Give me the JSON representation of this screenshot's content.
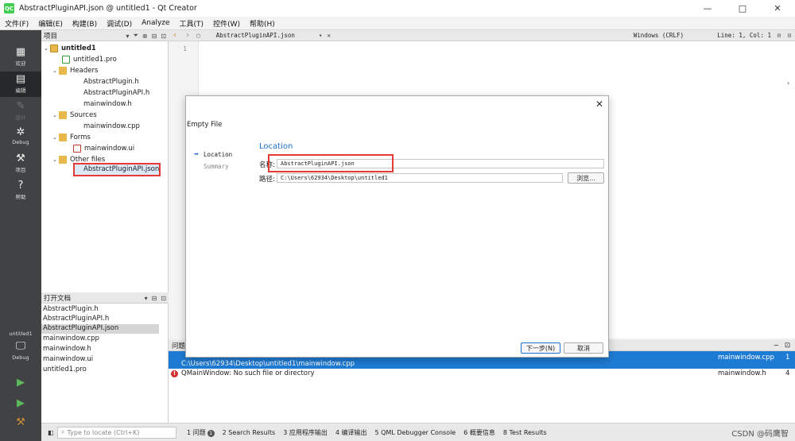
{
  "window": {
    "title": "AbstractPluginAPI.json @ untitled1 - Qt Creator",
    "controls": [
      "—",
      "□",
      "✕"
    ]
  },
  "menu": [
    "文件(F)",
    "编辑(E)",
    "构建(B)",
    "调试(D)",
    "Analyze",
    "工具(T)",
    "控件(W)",
    "帮助(H)"
  ],
  "modes": [
    {
      "label": "欢迎",
      "icon": "grid-icon",
      "glyph": "▦"
    },
    {
      "label": "编辑",
      "icon": "edit-icon",
      "glyph": "▤"
    },
    {
      "label": "设计",
      "icon": "design-icon",
      "glyph": "✎"
    },
    {
      "label": "Debug",
      "icon": "bug-icon",
      "glyph": "✲"
    },
    {
      "label": "项目",
      "icon": "wrench-icon",
      "glyph": "⚒"
    },
    {
      "label": "帮助",
      "icon": "help-icon",
      "glyph": "?"
    }
  ],
  "kit": {
    "name": "untitled1",
    "mode": "Debug"
  },
  "project_panel": {
    "title": "项目",
    "tree": {
      "project": "untitled1",
      "pro_file": "untitled1.pro",
      "headers": "Headers",
      "header_files": [
        "AbstractPlugin.h",
        "AbstractPluginAPI.h",
        "mainwindow.h"
      ],
      "sources": "Sources",
      "source_files": [
        "mainwindow.cpp"
      ],
      "forms": "Forms",
      "form_files": [
        "mainwindow.ui"
      ],
      "other": "Other files",
      "other_files": [
        "AbstractPluginAPI.json"
      ]
    }
  },
  "open_docs": {
    "title": "打开文档",
    "items": [
      "AbstractPlugin.h",
      "AbstractPluginAPI.h",
      "AbstractPluginAPI.json",
      "mainwindow.cpp",
      "mainwindow.h",
      "mainwindow.ui",
      "untitled1.pro"
    ],
    "selected_index": 2
  },
  "editor_toolbar": {
    "file": "AbstractPluginAPI.json",
    "encoding": "Windows (CRLF)",
    "position": "Line: 1, Col: 1"
  },
  "editor": {
    "line_number": "1"
  },
  "dialog": {
    "title": "Empty File",
    "steps": [
      "Location",
      "Summary"
    ],
    "page_title": "Location",
    "name_label": "名称:",
    "name_value": "AbstractPluginAPI.json",
    "path_label": "路径:",
    "path_value": "C:\\Users\\62934\\Desktop\\untitled1",
    "browse_label": "浏览...",
    "next_label": "下一步(N)",
    "cancel_label": "取消"
  },
  "issues": {
    "title": "问题",
    "rows": [
      {
        "message": "C:\\Users\\62934\\Desktop\\untitled1\\mainwindow.cpp",
        "file": "mainwindow.cpp",
        "line": "1"
      },
      {
        "message": "QMainWindow: No such file or directory",
        "file": "mainwindow.h",
        "line": "4"
      }
    ]
  },
  "statusbar": {
    "locator_placeholder": "Type to locate (Ctrl+K)",
    "tabs": [
      {
        "num": "1",
        "label": "问题",
        "badge": "1"
      },
      {
        "num": "2",
        "label": "Search Results"
      },
      {
        "num": "3",
        "label": "应用程序输出"
      },
      {
        "num": "4",
        "label": "编译输出"
      },
      {
        "num": "5",
        "label": "QML Debugger Console"
      },
      {
        "num": "6",
        "label": "概要信息"
      },
      {
        "num": "8",
        "label": "Test Results"
      }
    ]
  },
  "watermark": "CSDN @码鹰智",
  "colors": {
    "accent": "#1e7bd4",
    "highlight": "#e53935",
    "sidebar": "#404244"
  }
}
